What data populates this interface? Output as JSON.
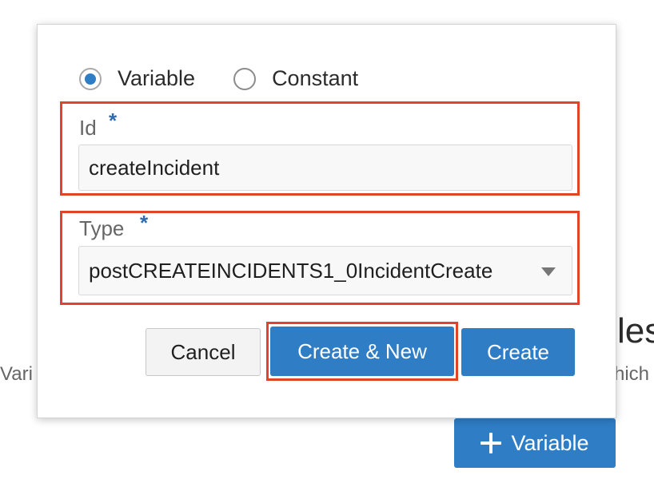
{
  "background": {
    "heading_fragment": "les",
    "text_fragment_left": "Vari",
    "text_fragment_right": "hich",
    "add_variable_label": "Variable"
  },
  "dialog": {
    "radios": [
      {
        "label": "Variable",
        "checked": true
      },
      {
        "label": "Constant",
        "checked": false
      }
    ],
    "id_field": {
      "label": "Id",
      "required_marker": "*",
      "value": "createIncident"
    },
    "type_field": {
      "label": "Type",
      "required_marker": "*",
      "selected_value": "postCREATEINCIDENTS1_0IncidentCreate"
    },
    "buttons": {
      "cancel": "Cancel",
      "create_and_new": "Create & New",
      "create": "Create"
    }
  },
  "colors": {
    "primary": "#2f7dc5",
    "highlight": "#e0452b",
    "required": "#2f6bb0"
  }
}
